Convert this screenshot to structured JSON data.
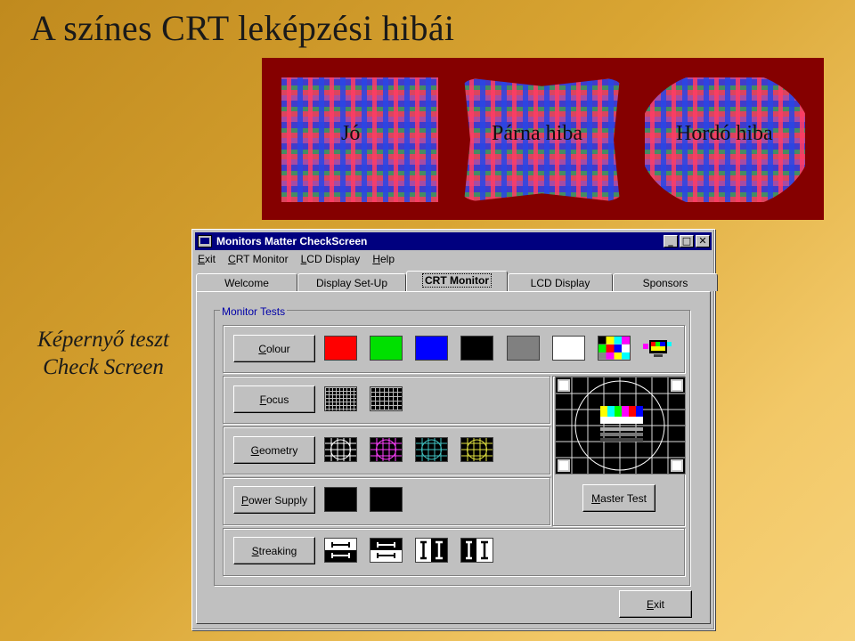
{
  "slide": {
    "title": "A színes CRT leképzési hibái",
    "caption_line1": "Képernyő teszt",
    "caption_line2": "Check Screen"
  },
  "distortion": {
    "labels": [
      "Jó",
      "Párna hiba",
      "Hordó hiba"
    ]
  },
  "window": {
    "title": "Monitors Matter CheckScreen",
    "minimize": "_",
    "maximize": "□",
    "close": "✕",
    "menu": [
      "Exit",
      "CRT Monitor",
      "LCD Display",
      "Help"
    ],
    "tabs": [
      "Welcome",
      "Display Set-Up",
      "CRT Monitor",
      "LCD Display",
      "Sponsors"
    ],
    "active_tab": "CRT Monitor",
    "group_title": "Monitor Tests",
    "buttons": {
      "colour": "Colour",
      "focus": "Focus",
      "geometry": "Geometry",
      "power_supply": "Power Supply",
      "streaking": "Streaking",
      "master_test": "Master Test",
      "exit": "Exit"
    },
    "colour_swatches": [
      "#ff0000",
      "#00e000",
      "#0000ff",
      "#000000",
      "#808080",
      "#ffffff"
    ],
    "geometry_colors": [
      "#ffffff",
      "#ff40ff",
      "#40c0c0",
      "#e0e040"
    ]
  }
}
